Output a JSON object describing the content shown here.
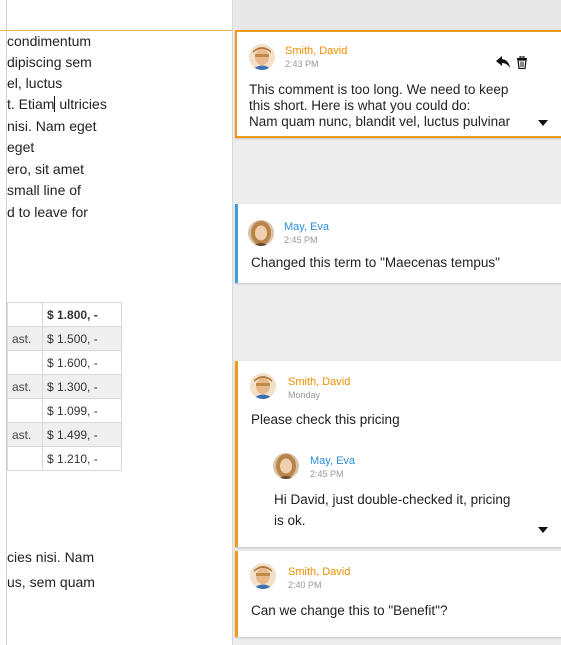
{
  "document": {
    "lines": [
      "condimentum",
      "dipiscing sem",
      "el, luctus",
      "t. Etiam",
      "ultricies",
      "nisi. Nam eget",
      "eget",
      "ero, sit amet",
      "small line of",
      "d to leave for",
      "cies nisi. Nam",
      "us, sem quam"
    ],
    "table": [
      {
        "label": "",
        "value": "$ 1.800, -"
      },
      {
        "label": "ast.",
        "value": "$ 1.500, -"
      },
      {
        "label": "",
        "value": "$ 1.600, -"
      },
      {
        "label": "ast.",
        "value": "$ 1.300, -"
      },
      {
        "label": "",
        "value": "$ 1.099, -"
      },
      {
        "label": "ast.",
        "value": "$ 1.499, -"
      },
      {
        "label": "",
        "value": "$ 1.210, -"
      }
    ]
  },
  "comments": [
    {
      "author": "Smith, David",
      "time": "2:43 PM",
      "text_lines": [
        "This comment is too long. We need to keep",
        "this short. Here is what you could do:",
        "Nam quam nunc, blandit vel, luctus pulvinar"
      ]
    },
    {
      "author": "May, Eva",
      "time": "2:45 PM",
      "text": "Changed this term to \"Maecenas tempus\""
    },
    {
      "author": "Smith, David",
      "time": "Monday",
      "text": "Please check this pricing",
      "reply": {
        "author": "May, Eva",
        "time": "2:45 PM",
        "text_lines": [
          "Hi David, just double-checked it, pricing",
          "is ok."
        ]
      }
    },
    {
      "author": "Smith, David",
      "time": "2:40 PM",
      "text": "Can we change this to \"Benefit\"?"
    }
  ],
  "icons": {
    "reply": "reply-arrow-icon",
    "delete": "trash-icon",
    "expand": "expand-caret-icon"
  },
  "colors": {
    "orange": "#f29a1b",
    "blue": "#3aa0e0"
  }
}
